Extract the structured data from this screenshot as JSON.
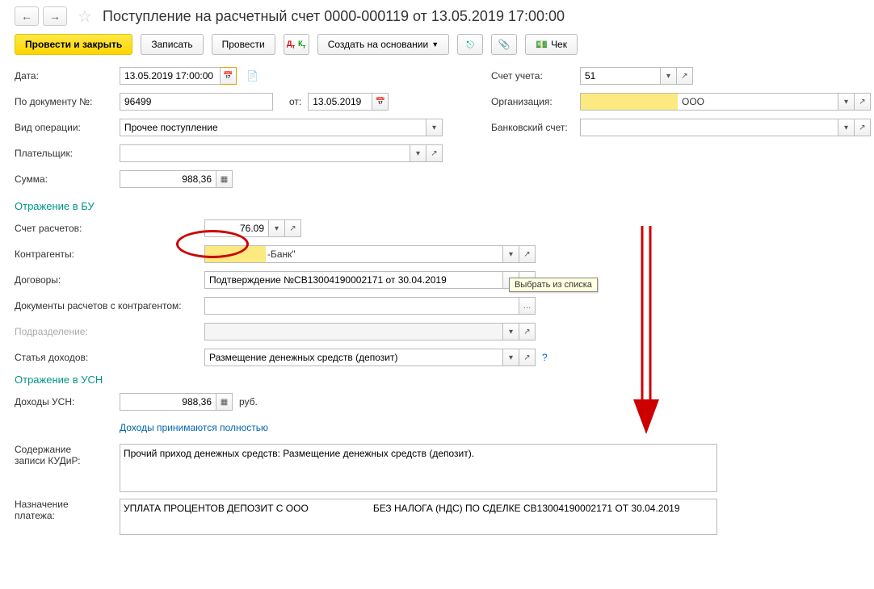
{
  "nav": {
    "back": "←",
    "forward": "→"
  },
  "title": "Поступление на расчетный счет 0000-000119 от 13.05.2019 17:00:00",
  "toolbar": {
    "main": "Провести и закрыть",
    "save": "Записать",
    "post": "Провести",
    "createBased": "Создать на основании",
    "check": "Чек"
  },
  "form": {
    "dateLabel": "Дата:",
    "dateValue": "13.05.2019 17:00:00",
    "docNumLabel": "По документу №:",
    "docNumValue": "96499",
    "docDateLabel": "от:",
    "docDateValue": "13.05.2019",
    "opTypeLabel": "Вид операции:",
    "opTypeValue": "Прочее поступление",
    "payerLabel": "Плательщик:",
    "payerValue": "",
    "sumLabel": "Сумма:",
    "sumValue": "988,36",
    "accountLabel": "Счет учета:",
    "accountValue": "51",
    "orgLabel": "Организация:",
    "orgSuffix": "ООО",
    "bankAccLabel": "Банковский счет:"
  },
  "bu": {
    "header": "Отражение в БУ",
    "settlementLabel": "Счет расчетов:",
    "settlementValue": "76.09",
    "counterpartyLabel": "Контрагенты:",
    "counterpartySuffix": "-Банк\"",
    "contractLabel": "Договоры:",
    "contractValue": "Подтверждение №СВ13004190002171 от 30.04.2019",
    "settlementDocsLabel": "Документы расчетов с контрагентом:",
    "divisionLabel": "Подразделение:",
    "incomeItemLabel": "Статья доходов:",
    "incomeItemValue": "Размещение денежных средств (депозит)"
  },
  "usn": {
    "header": "Отражение в УСН",
    "incomeLabel": "Доходы УСН:",
    "incomeValue": "988,36",
    "incomeUnit": "руб.",
    "fullIncomeLink": "Доходы принимаются полностью"
  },
  "kudir": {
    "label1": "Содержание",
    "label2": "записи КУДиР:",
    "value": "Прочий приход денежных средств: Размещение денежных средств (депозит)."
  },
  "purpose": {
    "label1": "Назначение",
    "label2": "платежа:",
    "value": "УПЛАТА ПРОЦЕНТОВ ДЕПОЗИТ С ООО                        БЕЗ НАЛОГА (НДС) ПО СДЕЛКЕ СВ13004190002171 ОТ 30.04.2019"
  },
  "tooltip": "Выбрать из списка"
}
